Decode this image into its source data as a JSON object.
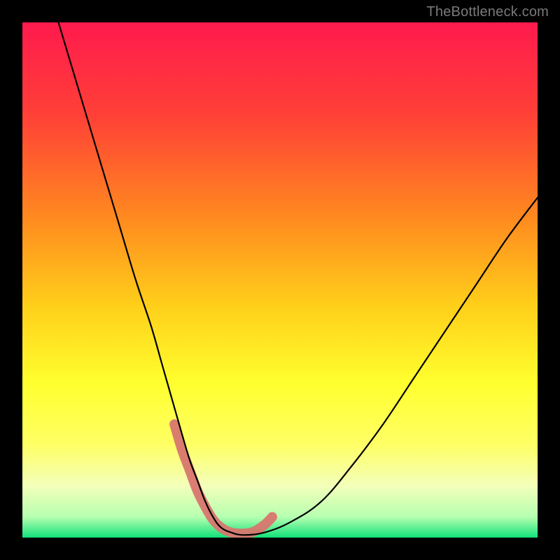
{
  "watermark": "TheBottleneck.com",
  "chart_data": {
    "type": "line",
    "title": "",
    "xlabel": "",
    "ylabel": "",
    "xlim": [
      0,
      100
    ],
    "ylim": [
      0,
      100
    ],
    "grid": false,
    "legend": false,
    "background_gradient": {
      "top_color": "#ff1a4d",
      "mid_colors": [
        "#ff6a2a",
        "#ffd21a",
        "#ffff33",
        "#f6ffbf"
      ],
      "bottom_color": "#11e07a"
    },
    "series": [
      {
        "name": "bottleneck-curve",
        "stroke": "#000000",
        "x": [
          7,
          10,
          13,
          16,
          19,
          22,
          25,
          27,
          29,
          31,
          32.5,
          34,
          35.5,
          37,
          38.5,
          40.5,
          43,
          47,
          52,
          58,
          64,
          70,
          76,
          82,
          88,
          94,
          100
        ],
        "y": [
          100,
          90,
          80,
          70,
          60,
          50,
          41,
          34,
          27,
          20,
          15,
          11,
          7,
          4,
          2,
          1,
          0.5,
          1,
          3,
          7,
          14,
          22,
          31,
          40,
          49,
          58,
          66
        ]
      }
    ],
    "highlight": {
      "name": "highlight-band",
      "stroke": "#d8766f",
      "width": 14,
      "x": [
        29.5,
        31,
        32.5,
        34,
        35.5,
        37,
        38.5,
        40.5,
        43,
        45,
        47,
        48.5
      ],
      "y": [
        22,
        17,
        13,
        9,
        6,
        3.5,
        2,
        1,
        0.8,
        1.2,
        2.5,
        4
      ]
    }
  }
}
